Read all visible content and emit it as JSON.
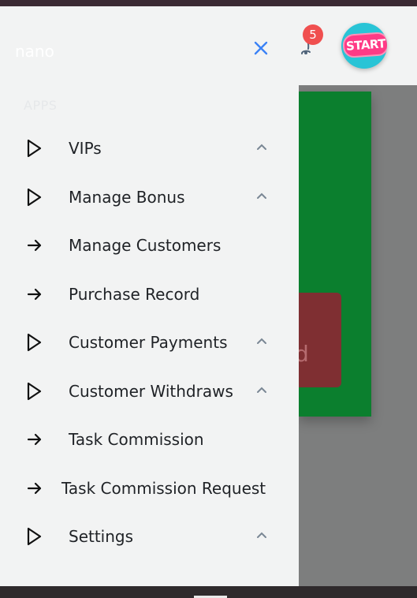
{
  "header": {
    "brand": "nano",
    "notification_count": "5",
    "start_label": "START"
  },
  "sidebar": {
    "section_label": "APPS",
    "items": [
      {
        "label": "VIPs",
        "icon": "play-outline-icon",
        "expandable": true
      },
      {
        "label": "Manage Bonus",
        "icon": "play-outline-icon",
        "expandable": true
      },
      {
        "label": "Manage Customers",
        "icon": "arrow-right-icon",
        "expandable": false
      },
      {
        "label": "Purchase Record",
        "icon": "arrow-right-icon",
        "expandable": false
      },
      {
        "label": "Customer Payments",
        "icon": "play-outline-icon",
        "expandable": true
      },
      {
        "label": "Customer Withdraws",
        "icon": "play-outline-icon",
        "expandable": true
      },
      {
        "label": "Task Commission",
        "icon": "arrow-right-icon",
        "expandable": false
      },
      {
        "label": "Task Commission Request",
        "icon": "arrow-right-icon",
        "expandable": false
      },
      {
        "label": "Settings",
        "icon": "play-outline-icon",
        "expandable": true
      }
    ]
  },
  "background": {
    "button_fragment": "d"
  },
  "colors": {
    "accent_close": "#3b82f6",
    "badge": "#f04f4f",
    "green_card": "#0b7f2e",
    "overlay": "#7d7e7e"
  }
}
